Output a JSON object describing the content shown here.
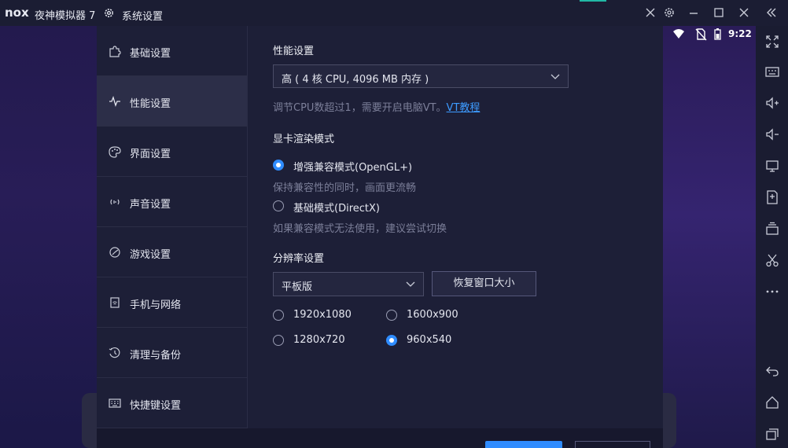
{
  "titlebar": {
    "logo": "nox",
    "app_title": "夜神模拟器 7",
    "dialog_title": "系统设置",
    "accent_color": "#22b8a5",
    "icons": [
      "close-icon",
      "gear-icon",
      "minimize-icon",
      "maximize-icon",
      "close-window-icon",
      "collapse-icon"
    ]
  },
  "statusbar": {
    "time": "9:22",
    "icons": [
      "wifi-icon",
      "no-sim-icon",
      "battery-icon"
    ]
  },
  "sidebar": {
    "items": [
      {
        "label": "基础设置",
        "icon": "puzzle-icon"
      },
      {
        "label": "性能设置",
        "icon": "pulse-icon",
        "active": true
      },
      {
        "label": "界面设置",
        "icon": "palette-icon"
      },
      {
        "label": "声音设置",
        "icon": "sound-icon"
      },
      {
        "label": "游戏设置",
        "icon": "gamepad-icon"
      },
      {
        "label": "手机与网络",
        "icon": "phone-icon"
      },
      {
        "label": "清理与备份",
        "icon": "history-icon"
      },
      {
        "label": "快捷键设置",
        "icon": "keyboard-icon"
      }
    ]
  },
  "performance": {
    "title": "性能设置",
    "preset_value": "高 ( 4 核 CPU, 4096 MB 内存 )",
    "hint": "调节CPU数超过1，需要开启电脑VT。",
    "hint_link": "VT教程"
  },
  "render": {
    "title": "显卡渲染模式",
    "options": [
      {
        "label": "增强兼容模式(OpenGL+)",
        "desc": "保持兼容性的同时，画面更流畅",
        "selected": true
      },
      {
        "label": "基础模式(DirectX)",
        "desc": "如果兼容模式无法使用，建议尝试切换",
        "selected": false
      }
    ]
  },
  "resolution": {
    "title": "分辨率设置",
    "mode_value": "平板版",
    "restore_button": "恢复窗口大小",
    "options": [
      {
        "label": "1920x1080",
        "selected": false
      },
      {
        "label": "1600x900",
        "selected": false
      },
      {
        "label": "1280x720",
        "selected": false
      },
      {
        "label": "960x540",
        "selected": true
      }
    ]
  },
  "rightbar": {
    "icons": [
      "fullscreen-icon",
      "keyboard-map-icon",
      "volume-up-icon",
      "volume-down-icon",
      "screen-icon",
      "apk-install-icon",
      "multi-instance-icon",
      "scissors-icon",
      "more-icon",
      "back-icon",
      "home-icon",
      "recents-icon"
    ]
  },
  "colors": {
    "primary": "#2f8cff",
    "link": "#3d9bff",
    "panel": "#1d1f37",
    "active_item": "#2c2e48"
  }
}
